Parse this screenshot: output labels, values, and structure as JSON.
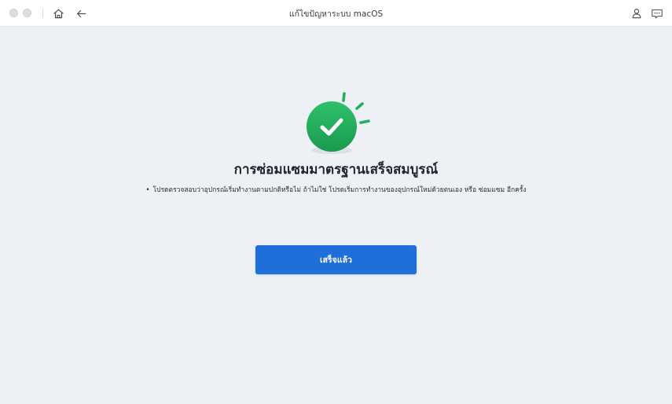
{
  "window": {
    "title": "แก้ไขปัญหาระบบ macOS"
  },
  "toolbar": {
    "home_icon": "home-icon",
    "back_icon": "arrow-left-icon",
    "account_icon": "user-icon",
    "feedback_icon": "message-icon"
  },
  "main": {
    "success_icon": "check-circle-icon",
    "heading": "การซ่อมแซมมาตรฐานเสร็จสมบูรณ์",
    "bullet": "•",
    "note": "โปรดตรวจสอบว่าอุปกรณ์เริ่มทำงานตามปกติหรือไม่ ถ้าไม่ใช่ โปรดเริ่มการทำงานของอุปกรณ์ใหม่ด้วยตนเอง หรือ ซ่อมแซม อีกครั้ง",
    "done_button": "เสร็จแล้ว"
  },
  "colors": {
    "accent": "#1e6fd9",
    "success": "#22a35a",
    "background": "#edf1f6"
  }
}
